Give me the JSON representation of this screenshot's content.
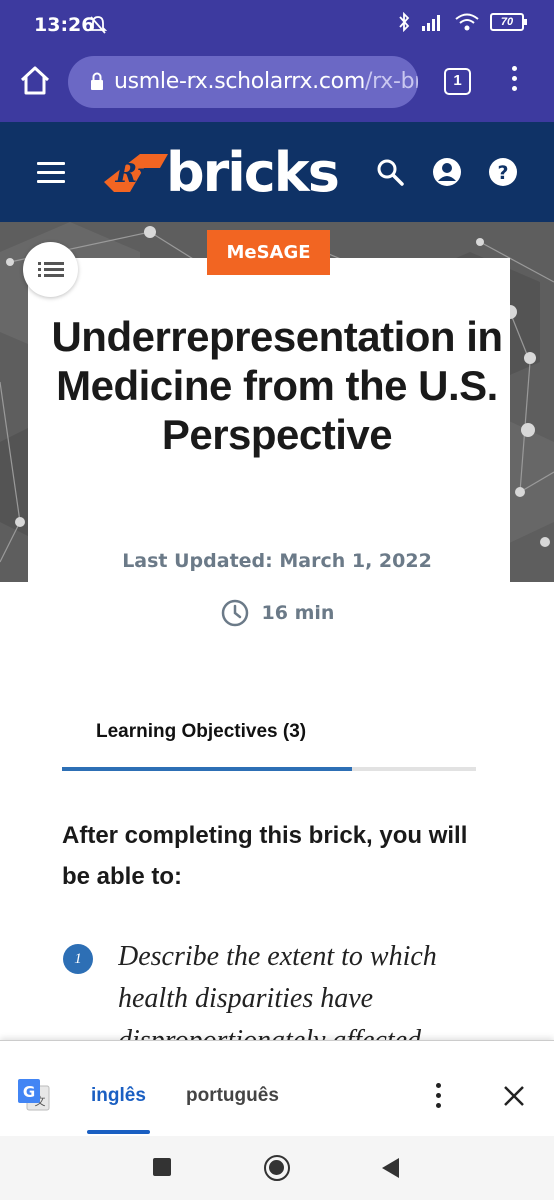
{
  "status_bar": {
    "time": "13:26",
    "battery": "70"
  },
  "browser": {
    "url_host": "usmle-rx.scholarrx.com",
    "url_path": "/rx-br",
    "tab_count": "1"
  },
  "site_header": {
    "logo_text": "bricks",
    "logo_mark": "Rx"
  },
  "article": {
    "tag": "MeSAGE",
    "title": "Underrepresentation in Medicine from the U.S. Perspective",
    "last_updated": "Last Updated: March 1, 2022",
    "duration": "16 min"
  },
  "learning_objectives": {
    "tab_label": "Learning Objectives (3)",
    "progress_fraction": 0.7,
    "intro": "After completing this brick, you will be able to:",
    "items": [
      {
        "number": "1",
        "text": "Describe the extent to which health disparities have disproportionately affected"
      }
    ]
  },
  "translate_bar": {
    "lang_active": "inglês",
    "lang_other": "português"
  },
  "colors": {
    "status_bar": "#3d3a9f",
    "site_header": "#0f3266",
    "tag": "#f26522",
    "accent_blue": "#2d6fb5",
    "translate_active": "#1a5fc2"
  }
}
